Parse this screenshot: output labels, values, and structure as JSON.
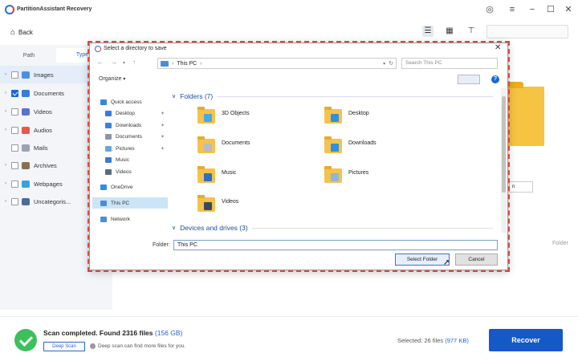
{
  "app": {
    "title": "PartitionAssistant Recovery"
  },
  "header": {
    "back_label": "Back"
  },
  "sidebar": {
    "tabs": [
      "Path",
      "Type"
    ],
    "items": [
      {
        "label": "Images",
        "checked": false,
        "selected": true,
        "color": "#4a90e2"
      },
      {
        "label": "Documents",
        "checked": true,
        "selected": false,
        "color": "#3a7bd5"
      },
      {
        "label": "Videos",
        "checked": false,
        "selected": false,
        "color": "#5b6fd6"
      },
      {
        "label": "Audios",
        "checked": false,
        "selected": false,
        "color": "#e8584d"
      },
      {
        "label": "Mails",
        "checked": false,
        "selected": false,
        "color": "#9aa4b1"
      },
      {
        "label": "Archives",
        "checked": false,
        "selected": false,
        "color": "#8a6f4e"
      },
      {
        "label": "Webpages",
        "checked": false,
        "selected": false,
        "color": "#36a3e0"
      },
      {
        "label": "Uncategoris...",
        "checked": false,
        "selected": false,
        "color": "#4b6b9a"
      }
    ]
  },
  "right_panel": {
    "input_value": "n",
    "column_label": "Folder"
  },
  "dialog": {
    "title": "Select a directory to save",
    "address": "This PC",
    "search_placeholder": "Search This PC",
    "organize_label": "Organize",
    "nav": [
      {
        "label": "Quick access",
        "pin": false
      },
      {
        "label": "Desktop",
        "pin": true
      },
      {
        "label": "Downloads",
        "pin": true
      },
      {
        "label": "Documents",
        "pin": true
      },
      {
        "label": "Pictures",
        "pin": true
      },
      {
        "label": "Music",
        "pin": false
      },
      {
        "label": "Videos",
        "pin": false
      },
      {
        "label": "OneDrive",
        "pin": false
      },
      {
        "label": "This PC",
        "pin": false
      },
      {
        "label": "Network",
        "pin": false
      }
    ],
    "folders_heading": "Folders (7)",
    "folders": [
      "3D Objects",
      "Desktop",
      "Documents",
      "Downloads",
      "Music",
      "Pictures",
      "Videos"
    ],
    "devices_heading": "Devices and drives (3)",
    "folder_label": "Folder:",
    "folder_value": "This PC",
    "select_button": "Select Folder",
    "cancel_button": "Cancel"
  },
  "status": {
    "scan_text": "Scan completed. Found 2316 files",
    "scan_size": "(156 GB)",
    "deep_scan_button": "Deep Scan",
    "deep_scan_note": "Deep scan can find more files for you.",
    "selected_text": "Selected: 26 files",
    "selected_size": "(977 KB)",
    "recover_button": "Recover"
  }
}
